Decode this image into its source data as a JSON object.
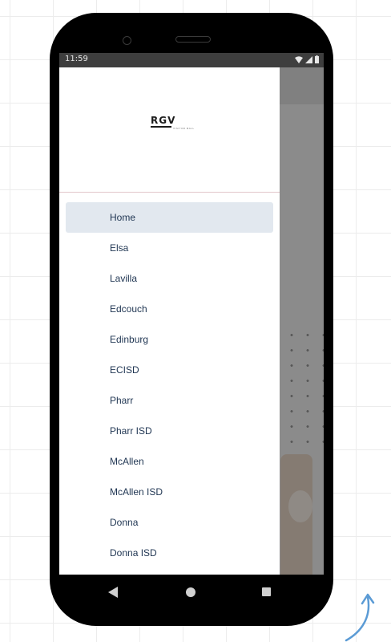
{
  "status_bar": {
    "time": "11:59"
  },
  "drawer": {
    "logo": {
      "text": "RGV",
      "subtext": "VISITOR MALL"
    },
    "items": [
      {
        "label": "Home",
        "active": true
      },
      {
        "label": "Elsa"
      },
      {
        "label": "Lavilla"
      },
      {
        "label": "Edcouch"
      },
      {
        "label": "Edinburg"
      },
      {
        "label": "ECISD"
      },
      {
        "label": "Pharr"
      },
      {
        "label": "Pharr ISD"
      },
      {
        "label": "McAllen"
      },
      {
        "label": "McAllen ISD"
      },
      {
        "label": "Donna"
      },
      {
        "label": "Donna ISD"
      }
    ]
  },
  "nav_bar": {
    "back_icon": "triangle-back-icon",
    "home_icon": "circle-home-icon",
    "recent_icon": "square-recents-icon"
  },
  "colors": {
    "active_item_bg": "#e2e8ef",
    "menu_text": "#1f3552",
    "arrow": "#5b9bd5"
  }
}
